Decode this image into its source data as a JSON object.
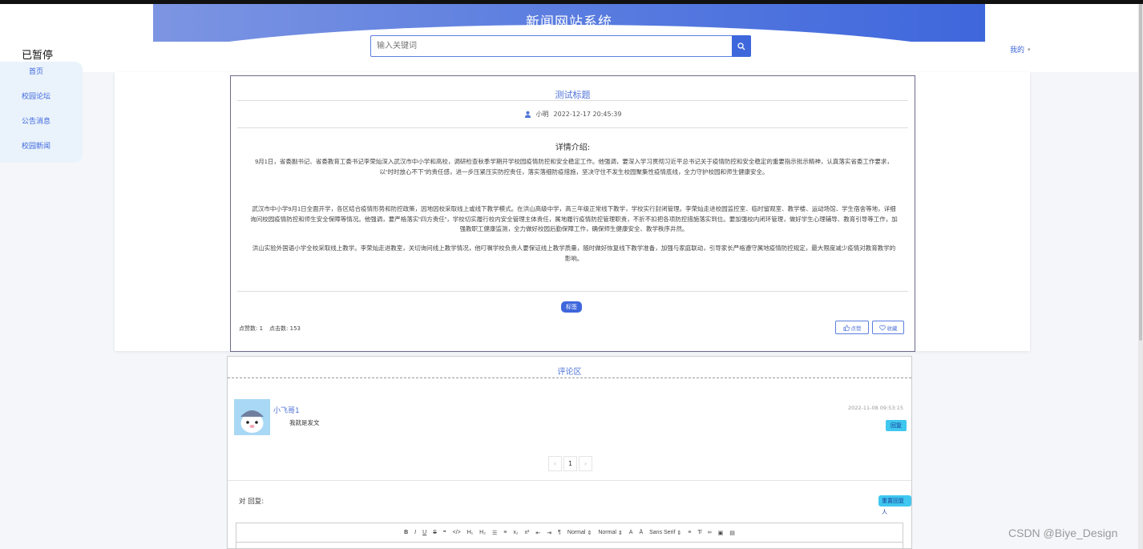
{
  "header": {
    "site_title": "新闻网站系统",
    "search_placeholder": "输入关键词",
    "user_menu_label": "我的"
  },
  "overlay": {
    "paused_label": "已暂停"
  },
  "sidebar": {
    "items": [
      {
        "label": "首页"
      },
      {
        "label": "校园论坛"
      },
      {
        "label": "公告消息"
      },
      {
        "label": "校园新闻"
      }
    ]
  },
  "article": {
    "title": "测试标题",
    "author": "小明",
    "datetime": "2022-12-17 20:45:39",
    "section_title": "详情介绍:",
    "paragraphs": [
      "9月1日，省委副书记、省委教育工委书记李荣灿深入武汉市中小学和高校，调研检查秋季学期开学校园疫情防控和安全稳定工作。他强调，要深入学习贯彻习近平总书记关于疫情防控和安全稳定的重要指示批示精神，认真落实省委工作要求，以“时时放心不下”的责任感，进一步压紧压实防控责任，落实落细防疫措施，坚决守住不发生校园聚集性疫情底线，全力守护校园和师生健康安全。",
      "武汉市中小学9月1日全面开学，各区结合疫情形势和防控政策，因地因校采取线上或线下教学模式。在洪山高级中学，高三年级正常线下教学，学校实行封闭管理。李荣灿走进校园监控室、临时留观室、教学楼、运动场馆、学生宿舍等地，详细询问校园疫情防控和师生安全保障等情况。他强调，要严格落实“四方责任”，学校切实履行校内安全管理主体责任，属地履行疫情防控管理职责，不折不扣把各项防控措施落实到位。要加强校内闭环管理，做好学生心理辅导、教育引导等工作，加强教职工健康监测，全力做好校园后勤保障工作，确保师生健康安全、教学秩序井然。",
      "洪山实验外国语小学全校采取线上教学。李荣灿走进教室，关切询问线上教学情况，他叮嘱学校负责人要保证线上教学质量，随时做好恢复线下教学准备，加强与家庭联动，引导家长严格遵守属地疫情防控规定，最大限度减少疫情对教育教学的影响。"
    ],
    "tag": "标签",
    "like_count_label": "点赞数: 1",
    "click_count_label": "点击数: 153",
    "like_button": "点赞",
    "favorite_button": "收藏"
  },
  "comments": {
    "header": "评论区",
    "items": [
      {
        "user": "小飞哥1",
        "content": "我就是发文",
        "time": "2022-11-08 09:53:15",
        "reply_label": "回复"
      }
    ],
    "pager": {
      "prev": "‹",
      "current": "1",
      "next": "›"
    },
    "reply_prompt": "对 回复:",
    "reset_button": "重置回复人",
    "toolbar": {
      "header_select": "Normal",
      "size_select": "Normal",
      "font_select": "Sans Serif"
    }
  },
  "watermark": "CSDN @Biye_Design",
  "colors": {
    "primary": "#3f67dc",
    "accent": "#3fc7ef",
    "sidebar_bg": "#eaf3fb"
  }
}
